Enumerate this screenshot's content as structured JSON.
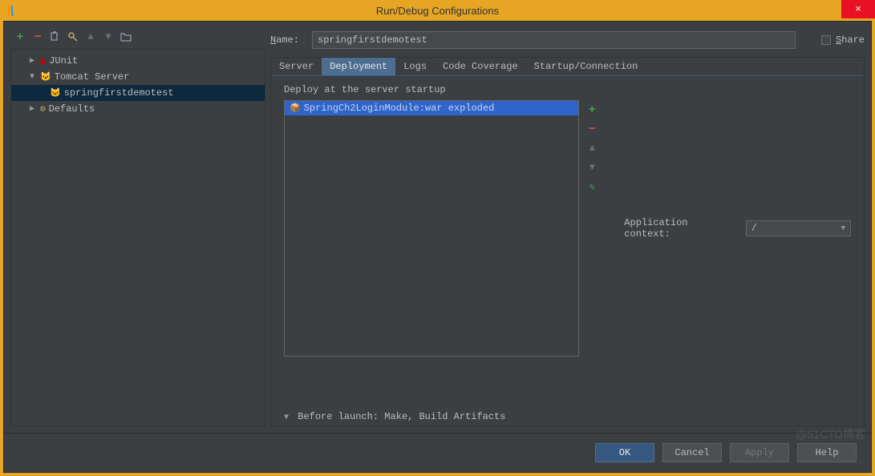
{
  "window": {
    "title": "Run/Debug Configurations"
  },
  "toolbar": {
    "add_tip": "Add New Configuration",
    "remove_tip": "Remove",
    "copy_tip": "Copy",
    "edit_tip": "Edit Defaults",
    "up_tip": "Move Up",
    "down_tip": "Move Down",
    "folder_tip": "Create Folder"
  },
  "tree": {
    "items": [
      {
        "label": "JUnit",
        "level": 1,
        "expanded": false,
        "icon": "junit",
        "toggle": "▶"
      },
      {
        "label": "Tomcat Server",
        "level": 1,
        "expanded": true,
        "icon": "tomcat",
        "toggle": "▼"
      },
      {
        "label": "springfirstdemotest",
        "level": 2,
        "selected": true,
        "icon": "tomcat"
      },
      {
        "label": "Defaults",
        "level": 1,
        "expanded": false,
        "icon": "defaults",
        "toggle": "▶"
      }
    ]
  },
  "name": {
    "label_full": "Name:",
    "value": "springfirstdemotest"
  },
  "share": {
    "label_full": "Share"
  },
  "tabs": [
    {
      "label": "Server"
    },
    {
      "label": "Deployment",
      "active": true
    },
    {
      "label": "Logs"
    },
    {
      "label": "Code Coverage"
    },
    {
      "label": "Startup/Connection"
    }
  ],
  "deploy": {
    "header": "Deploy at the server startup",
    "artifact": "SpringCh2LoginModule:war exploded"
  },
  "app_context": {
    "label": "Application context:",
    "value": "/"
  },
  "before_launch": {
    "text": "Before launch: Make, Build Artifacts"
  },
  "buttons": {
    "ok": "OK",
    "cancel": "Cancel",
    "apply": "Apply",
    "help": "Help"
  },
  "watermark": "@51CTO博客"
}
